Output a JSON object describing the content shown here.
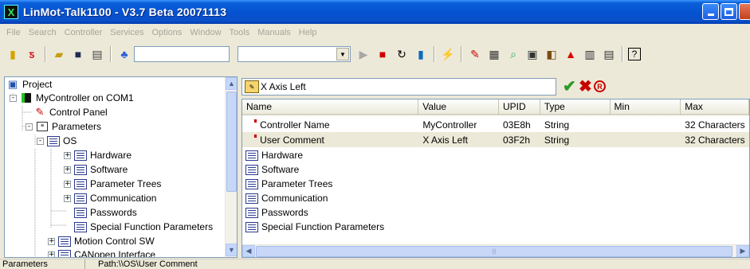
{
  "window": {
    "title": "LinMot-Talk1100 - V3.7 Beta 20071113",
    "app_icon_glyph": "X"
  },
  "menu": [
    "File",
    "Search",
    "Controller",
    "Services",
    "Options",
    "Window",
    "Tools",
    "Manuals",
    "Help"
  ],
  "toolbar": {
    "icons": [
      "new-project-icon",
      "open-icon",
      "folder-icon",
      "save-icon",
      "print-icon",
      "connect-icon",
      "play-icon",
      "stop-icon",
      "reset-icon",
      "controller-icon",
      "wand-icon",
      "config-icon",
      "parameter-icon",
      "oscilloscope-icon",
      "monitor-icon",
      "drive-icon",
      "warning-icon",
      "tools-icon",
      "list-icon",
      "help-icon"
    ],
    "input_value": "",
    "combo_value": ""
  },
  "tree": {
    "nodes": [
      {
        "label": "Project",
        "icon": "project-icon"
      },
      {
        "label": "MyController on COM1",
        "icon": "controller-icon",
        "expander": "-"
      },
      {
        "label": "Control Panel",
        "icon": "control-panel-icon"
      },
      {
        "label": "Parameters",
        "icon": "parameters-icon",
        "expander": "-"
      },
      {
        "label": "OS",
        "icon": "doc-icon",
        "expander": "-"
      },
      {
        "label": "Hardware",
        "icon": "doc-icon",
        "expander": "+"
      },
      {
        "label": "Software",
        "icon": "doc-icon",
        "expander": "+"
      },
      {
        "label": "Parameter Trees",
        "icon": "doc-icon",
        "expander": "+"
      },
      {
        "label": "Communication",
        "icon": "doc-icon",
        "expander": "+"
      },
      {
        "label": "Passwords",
        "icon": "doc-icon"
      },
      {
        "label": "Special Function Parameters",
        "icon": "doc-icon"
      },
      {
        "label": "Motion Control SW",
        "icon": "doc-icon",
        "expander": "+"
      },
      {
        "label": "CANopen Interface",
        "icon": "doc-icon",
        "expander": "+"
      }
    ]
  },
  "detail": {
    "path_value": "X Axis Left",
    "accept_icon": "✔",
    "cancel_icon": "✖",
    "reset_icon": "R",
    "columns": [
      "Name",
      "Value",
      "UPID",
      "Type",
      "Min",
      "Max"
    ],
    "rows": [
      {
        "name": "Controller Name",
        "value": "MyController",
        "upid": "03E8h",
        "type": "String",
        "min": "",
        "max": "32 Characters"
      },
      {
        "name": "User Comment",
        "value": "X Axis Left",
        "upid": "03F2h",
        "type": "String",
        "min": "",
        "max": "32 Characters"
      }
    ],
    "groups": [
      "Hardware",
      "Software",
      "Parameter Trees",
      "Communication",
      "Passwords",
      "Special Function Parameters"
    ]
  },
  "status": {
    "section": "Parameters",
    "path": "Path:\\\\OS\\User Comment"
  }
}
